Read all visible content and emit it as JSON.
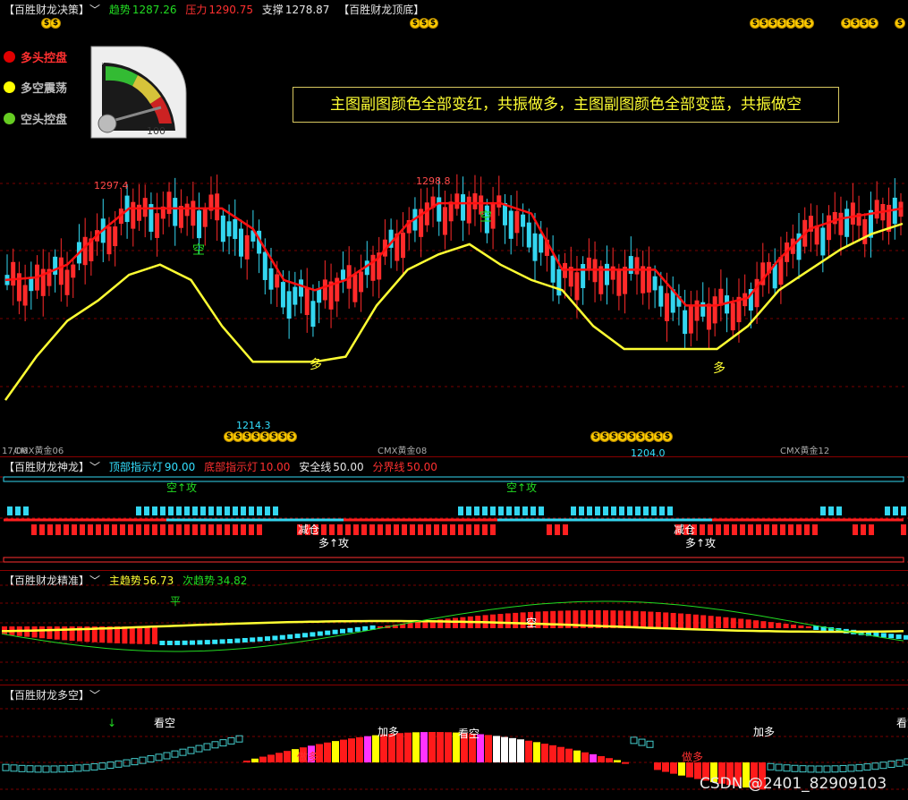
{
  "main": {
    "title": "【百胜财龙决策】",
    "trend_label": "趋势",
    "trend_value": "1287.26",
    "pressure_label": "压力",
    "pressure_value": "1290.75",
    "support_label": "支撑",
    "support_value": "1278.87",
    "top_bottom": "【百胜财龙顶底】",
    "legend": [
      "多头控盘",
      "多空震荡",
      "空头控盘"
    ],
    "gauge_min": "0",
    "gauge_max": "100",
    "note": "主图副图颜色全部变红，共振做多，主图副图颜色全部变蓝，共振做空",
    "price_high_1": "1297.4",
    "price_high_2": "1298.8",
    "price_low_1": "1214.3",
    "price_low_2": "1204.0",
    "label_kong": "空",
    "label_duo": "多",
    "contracts": [
      "CMX黄金06",
      "CMX黄金08",
      "CMX黄金12"
    ],
    "contract_prefix": "17/06"
  },
  "shenlong": {
    "title": "【百胜财龙神龙】",
    "top_light_label": "顶部指示灯",
    "top_light_value": "90.00",
    "bottom_light_label": "底部指示灯",
    "bottom_light_value": "10.00",
    "safe_label": "安全线",
    "safe_value": "50.00",
    "divide_label": "分界线",
    "divide_value": "50.00",
    "kong_attack": "空↑攻",
    "duo_attack": "多↑攻",
    "reduce": "减仓"
  },
  "jingzhun": {
    "title": "【百胜财龙精准】",
    "main_label": "主趋势",
    "main_value": "56.73",
    "sub_label": "次趋势",
    "sub_value": "34.82",
    "ping": "平",
    "kong": "空"
  },
  "duokong": {
    "title": "【百胜财龙多空】",
    "kankong": "看空",
    "jiaduo": "加多",
    "zuoduo": "做多"
  },
  "watermark": "CSDN @2401_82909103",
  "chart_data": [
    {
      "type": "line",
      "title": "",
      "series": [
        {
          "name": "",
          "color": "#ff2020",
          "values": [
            1262,
            1263,
            1268,
            1280,
            1290,
            1290,
            1290,
            1290,
            1282,
            1262,
            1258,
            1262,
            1270,
            1284,
            1292,
            1292,
            1292,
            1288,
            1266,
            1266,
            1266,
            1266,
            1252,
            1252,
            1255,
            1270,
            1282,
            1286,
            1288,
            1290
          ]
        },
        {
          "name": "",
          "color": "#ffff33",
          "values": [
            1215,
            1232,
            1246,
            1254,
            1264,
            1268,
            1262,
            1244,
            1230,
            1230,
            1230,
            1232,
            1252,
            1266,
            1272,
            1276,
            1268,
            1262,
            1258,
            1244,
            1235,
            1235,
            1235,
            1235,
            1244,
            1258,
            1266,
            1274,
            1280,
            1284
          ]
        }
      ],
      "ylim": [
        1200,
        1305
      ]
    }
  ]
}
